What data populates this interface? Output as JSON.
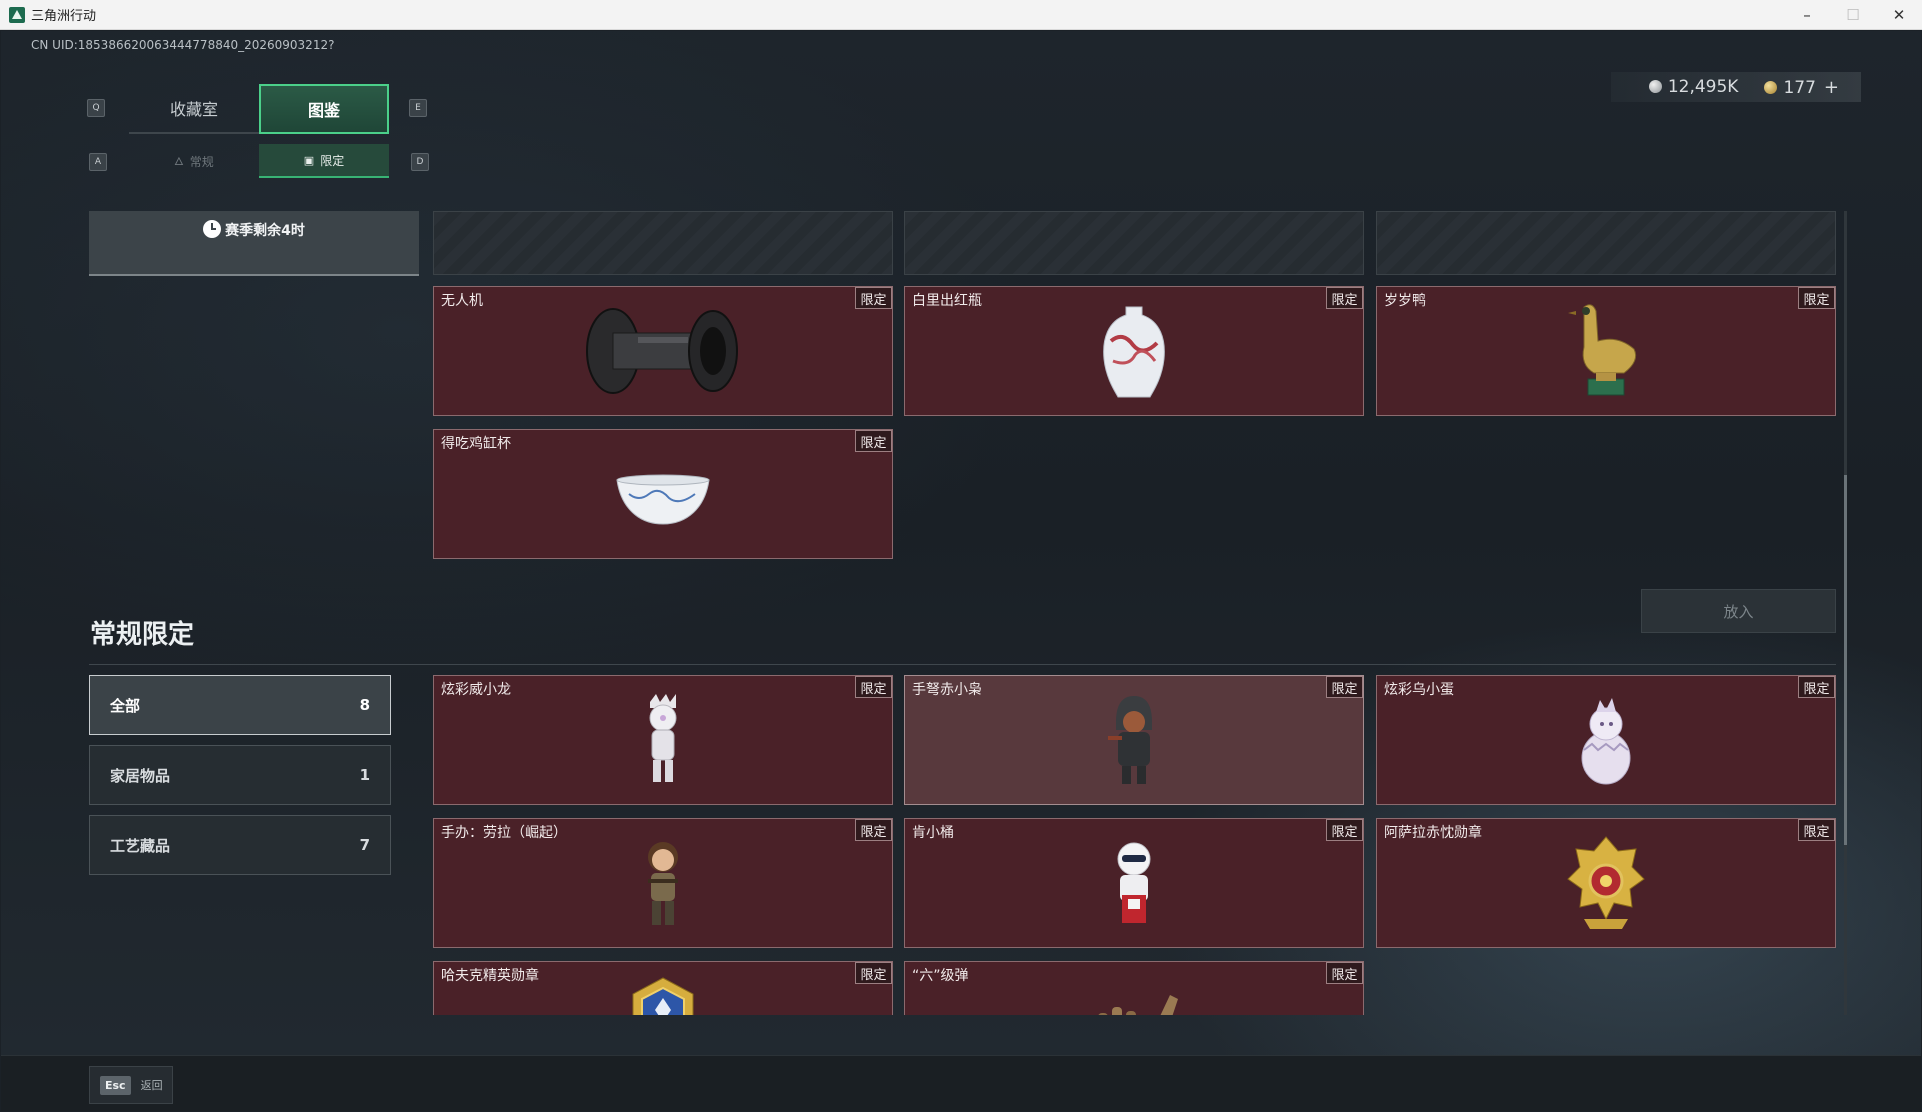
{
  "window": {
    "title": "三角洲行动",
    "minimize_glyph": "–",
    "maximize_glyph": "☐",
    "close_glyph": "✕"
  },
  "uid_text": "CN UID:185386620063444778840_20260903212?",
  "key_hints": {
    "prev_tab": "Q",
    "next_tab": "E",
    "prev_subtab": "A",
    "next_subtab": "D"
  },
  "main_tabs": [
    {
      "label": "收藏室",
      "active": false
    },
    {
      "label": "图鉴",
      "active": true
    }
  ],
  "sub_tabs": [
    {
      "label": "常规",
      "icon": "flame-icon",
      "active": false
    },
    {
      "label": "限定",
      "icon": "image-icon",
      "active": true
    }
  ],
  "currency": {
    "silver": "12,495K",
    "gold": "177",
    "plus": "+"
  },
  "season": {
    "text": "赛季剩余4时",
    "icon": "clock-icon"
  },
  "limited_badge": "限定",
  "season_items": [
    {
      "name": "无人机",
      "badge": "限定",
      "art": "drone-part"
    },
    {
      "name": "白里出红瓶",
      "badge": "限定",
      "art": "porcelain-vase"
    },
    {
      "name": "岁岁鸭",
      "badge": "限定",
      "art": "bronze-duck"
    },
    {
      "name": "得吃鸡缸杯",
      "badge": "限定",
      "art": "porcelain-cup"
    }
  ],
  "regular_section": {
    "title": "常规限定",
    "place_button": "放入",
    "filters": [
      {
        "label": "全部",
        "count": "8",
        "active": true
      },
      {
        "label": "家居物品",
        "count": "1",
        "active": false
      },
      {
        "label": "工艺藏品",
        "count": "7",
        "active": false
      }
    ],
    "items": [
      {
        "name": "炫彩威小龙",
        "badge": "限定",
        "art": "white-dragon-figure"
      },
      {
        "name": "手弩赤小枭",
        "badge": "限定",
        "art": "hooded-figure",
        "highlight": true
      },
      {
        "name": "炫彩乌小蛋",
        "badge": "限定",
        "art": "egg-figure"
      },
      {
        "name": "手办：劳拉（崛起）",
        "badge": "限定",
        "art": "lara-figure"
      },
      {
        "name": "肯小桶",
        "badge": "限定",
        "art": "colonel-figure"
      },
      {
        "name": "阿萨拉赤忱勋章",
        "badge": "限定",
        "art": "gold-medal"
      },
      {
        "name": "哈夫克精英勋章",
        "badge": "限定",
        "art": "blue-gold-badge"
      },
      {
        "name": "“六”级弹",
        "badge": "限定",
        "art": "bronze-hand"
      }
    ]
  },
  "bottom": {
    "esc_key": "Esc",
    "esc_label": "返回"
  }
}
